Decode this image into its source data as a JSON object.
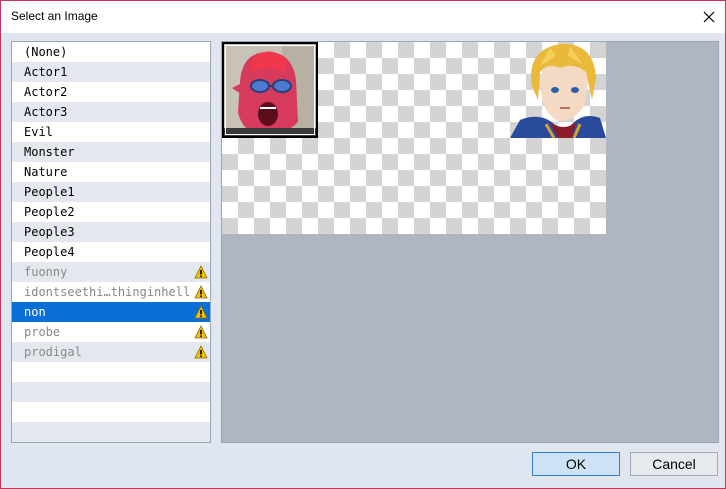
{
  "window": {
    "title": "Select an Image"
  },
  "list": {
    "items": [
      {
        "label": "(None)",
        "warning": false,
        "dim": false,
        "selected": false
      },
      {
        "label": "Actor1",
        "warning": false,
        "dim": false,
        "selected": false
      },
      {
        "label": "Actor2",
        "warning": false,
        "dim": false,
        "selected": false
      },
      {
        "label": "Actor3",
        "warning": false,
        "dim": false,
        "selected": false
      },
      {
        "label": "Evil",
        "warning": false,
        "dim": false,
        "selected": false
      },
      {
        "label": "Monster",
        "warning": false,
        "dim": false,
        "selected": false
      },
      {
        "label": "Nature",
        "warning": false,
        "dim": false,
        "selected": false
      },
      {
        "label": "People1",
        "warning": false,
        "dim": false,
        "selected": false
      },
      {
        "label": "People2",
        "warning": false,
        "dim": false,
        "selected": false
      },
      {
        "label": "People3",
        "warning": false,
        "dim": false,
        "selected": false
      },
      {
        "label": "People4",
        "warning": false,
        "dim": false,
        "selected": false
      },
      {
        "label": "fuonny",
        "warning": true,
        "dim": true,
        "selected": false
      },
      {
        "label": "idontseethi…thinginhell",
        "warning": true,
        "dim": true,
        "selected": false
      },
      {
        "label": "non",
        "warning": true,
        "dim": false,
        "selected": true
      },
      {
        "label": "probe",
        "warning": true,
        "dim": true,
        "selected": false
      },
      {
        "label": "prodigal",
        "warning": true,
        "dim": true,
        "selected": false
      },
      {
        "label": "",
        "warning": false,
        "dim": false,
        "selected": false
      },
      {
        "label": "",
        "warning": false,
        "dim": false,
        "selected": false
      },
      {
        "label": "",
        "warning": false,
        "dim": false,
        "selected": false
      },
      {
        "label": "",
        "warning": false,
        "dim": false,
        "selected": false
      }
    ]
  },
  "preview": {
    "faces": [
      {
        "name": "red-face",
        "selected": true
      },
      {
        "name": "blond-hero",
        "selected": false
      }
    ]
  },
  "buttons": {
    "ok": "OK",
    "cancel": "Cancel"
  },
  "colors": {
    "selection": "#0a6fd6",
    "warning": "#f5c400",
    "border_accent": "#c8355a"
  }
}
